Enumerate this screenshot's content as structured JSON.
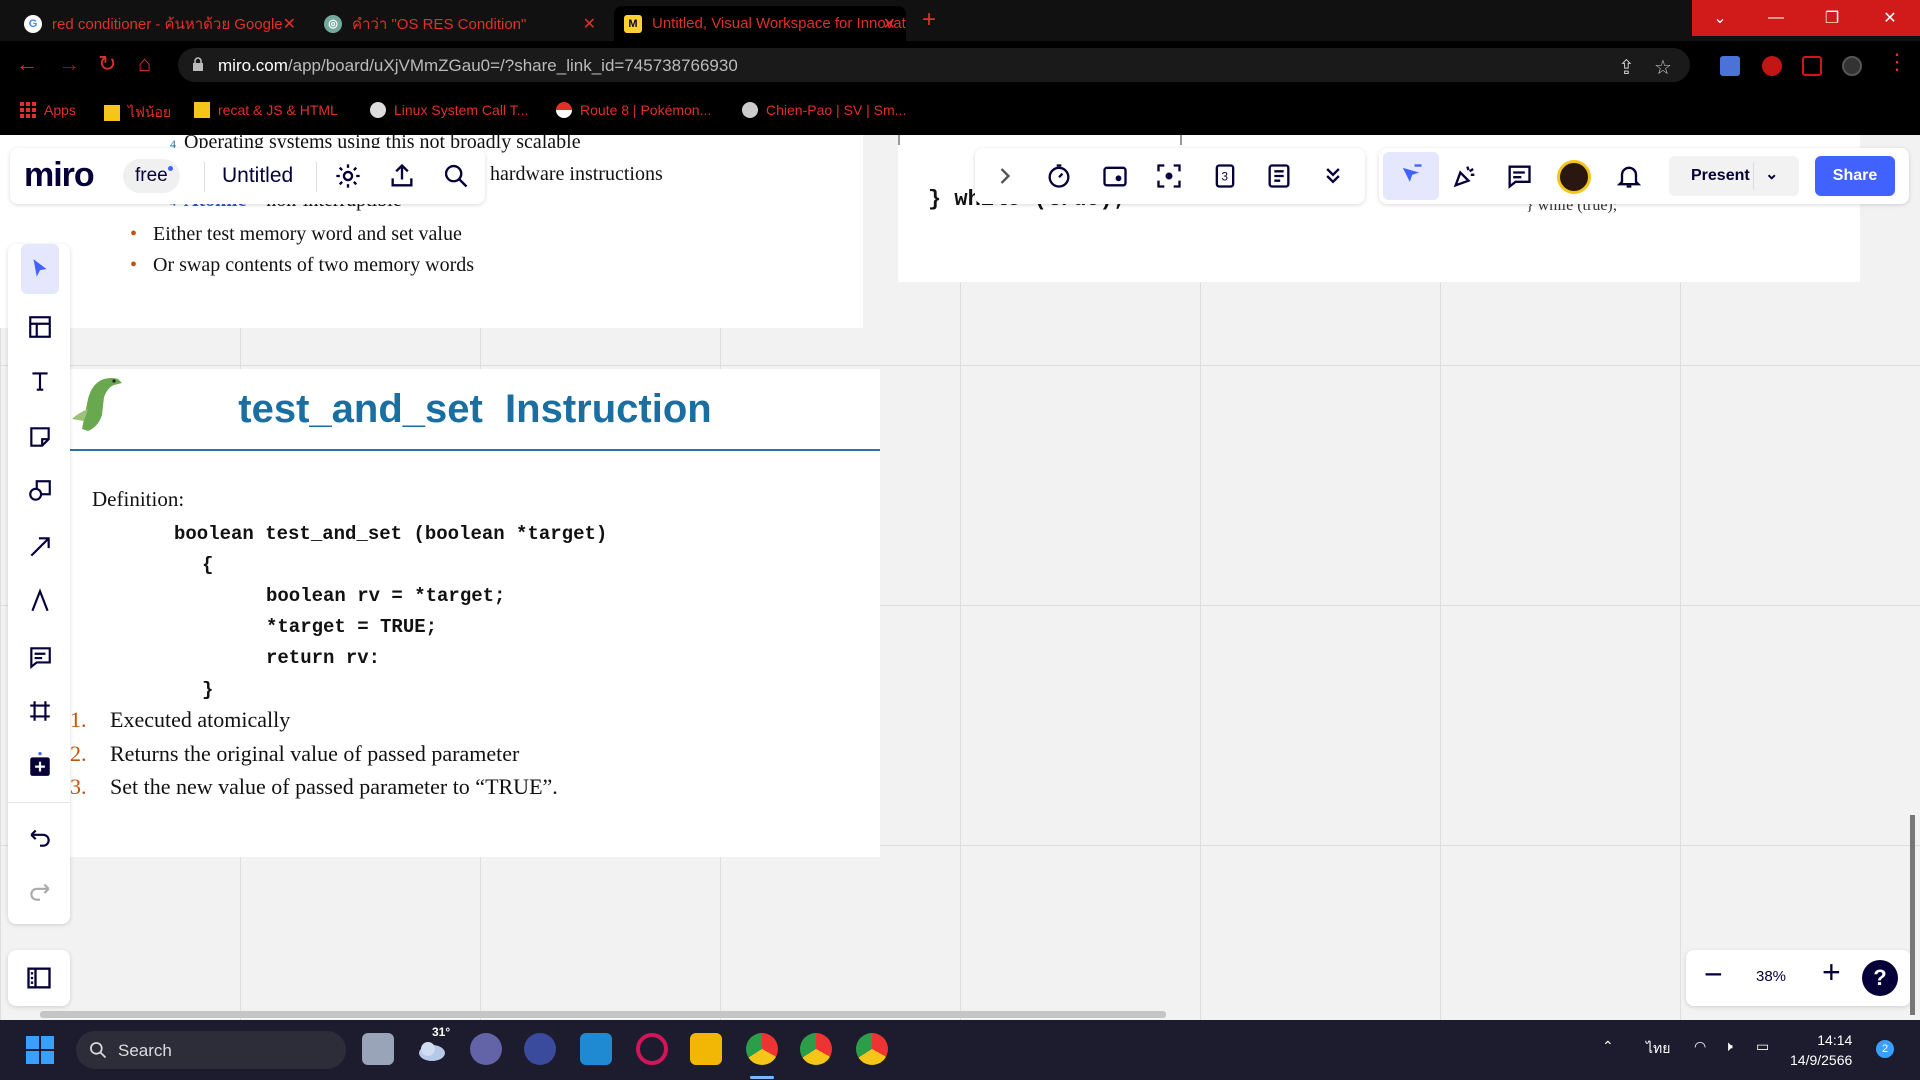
{
  "browser": {
    "tabs": [
      {
        "label": "red conditioner - ค้นหาด้วย Google",
        "icon": "google-icon"
      },
      {
        "label": "คำว่า \"OS RES Condition\"",
        "icon": "chatgpt-icon"
      },
      {
        "label": "Untitled, Visual Workspace for Innovation",
        "icon": "miro-icon"
      }
    ],
    "url_domain": "miro.com",
    "url_path": "/app/board/uXjVMmZGau0=/?share_link_id=745738766930",
    "bookmarks": [
      "Apps",
      "ไฟน้อย",
      "recat & JS & HTML",
      "Linux System Call T...",
      "Route 8 | Pokémon...",
      "Chien-Pao | SV | Sm..."
    ]
  },
  "miro": {
    "logo": "miro",
    "plan_badge": "free",
    "board_title": "Untitled",
    "present_label": "Present",
    "share_label": "Share",
    "zoom_level": "38%",
    "help_label": "?"
  },
  "slide_top": {
    "line1_prefix": "4",
    "line1": "Operating systems using this not broadly scalable",
    "line2": "hardware instructions",
    "line3_prefix": "4",
    "line3_atomic": "Atomic",
    "line3_rest": " – non-interruptible",
    "bullets": [
      "Either test memory word and set value",
      "Or swap contents of two memory words"
    ]
  },
  "slide_right": {
    "code_fragment": "} while (true);",
    "note_fragment": "} while (true);"
  },
  "slide_main": {
    "title": "test_and_set  Instruction",
    "definition_label": "Definition:",
    "code": {
      "signature": "boolean test_and_set (boolean *target)",
      "open_brace": "{",
      "line1": "boolean rv = *target;",
      "line2": "*target = TRUE;",
      "line3": "return rv:",
      "close_brace": "}"
    },
    "points": [
      {
        "num": "1.",
        "text": "Executed atomically"
      },
      {
        "num": "2.",
        "text": "Returns the original value of passed parameter"
      },
      {
        "num": "3.",
        "text": "Set the new value of passed parameter to “TRUE”."
      }
    ]
  },
  "taskbar": {
    "search_label": "Search",
    "weather": "31°",
    "lang": "ไทย",
    "time": "14:14",
    "date": "14/9/2566",
    "notifications": "2"
  },
  "colors": {
    "title_blue": "#1a6fa0",
    "miro_blue": "#4262ff",
    "bullet_orange": "#c0540a",
    "tab_red": "#e0302a"
  }
}
